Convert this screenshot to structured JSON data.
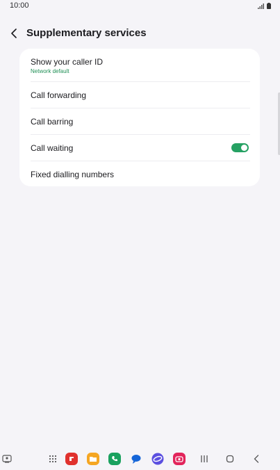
{
  "status_bar": {
    "time": "10:00"
  },
  "header": {
    "title": "Supplementary services"
  },
  "settings": [
    {
      "label": "Show your caller ID",
      "sublabel": "Network default"
    },
    {
      "label": "Call forwarding"
    },
    {
      "label": "Call barring"
    },
    {
      "label": "Call waiting",
      "toggle_on": true
    },
    {
      "label": "Fixed dialling numbers"
    }
  ],
  "colors": {
    "background": "#f5f4f8",
    "card": "#ffffff",
    "accent_green": "#26a163",
    "sublabel_green": "#1f8f55"
  },
  "taskbar": {
    "icons": [
      "edge-panel-icon",
      "apps-grid-icon",
      "flipboard-icon",
      "my-files-icon",
      "phone-icon",
      "messages-icon",
      "internet-icon",
      "screen-recorder-icon"
    ],
    "nav": [
      "recents-icon",
      "home-icon",
      "back-icon"
    ]
  }
}
